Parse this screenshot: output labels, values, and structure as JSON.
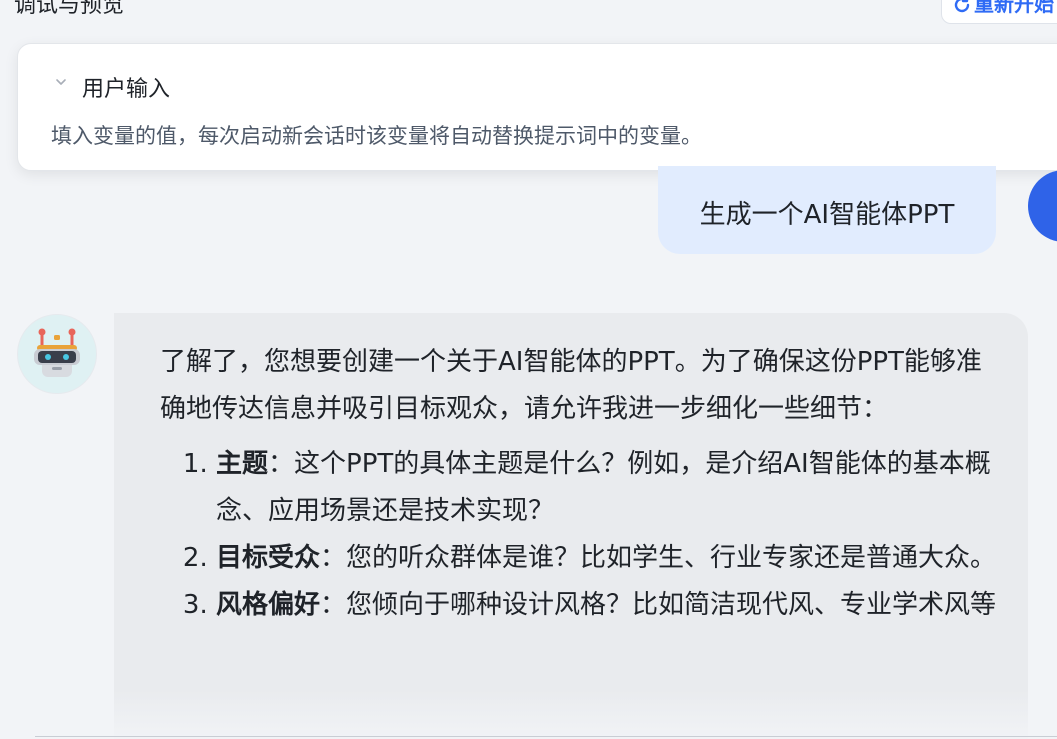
{
  "header": {
    "title": "调试与预览",
    "refresh_label": "重新开始"
  },
  "variables_card": {
    "title": "用户输入",
    "description": "填入变量的值，每次启动新会话时该变量将自动替换提示词中的变量。"
  },
  "conversation": {
    "user_message": "生成一个AI智能体PPT",
    "bot_intro": "了解了，您想要创建一个关于AI智能体的PPT。为了确保这份PPT能够准确地传达信息并吸引目标观众，请允许我进一步细化一些细节：",
    "bot_items": [
      {
        "term": "主题",
        "text": "：这个PPT的具体主题是什么？例如，是介绍AI智能体的基本概念、应用场景还是技术实现？"
      },
      {
        "term": "目标受众",
        "text": "：您的听众群体是谁？比如学生、行业专家还是普通大众。"
      },
      {
        "term": "风格偏好",
        "text": "：您倾向于哪种设计风格？比如简洁现代风、专业学术风等"
      }
    ]
  },
  "colors": {
    "accent": "#2f6bf5",
    "user_bubble": "#e1ecfe",
    "bot_bubble": "#e9ebee",
    "user_avatar": "#2f63e8",
    "bot_avatar_bg": "#dff1f3"
  },
  "icons": {
    "refresh": "refresh-icon",
    "collapse": "chevron-down-icon",
    "bot_avatar": "robot-icon"
  }
}
